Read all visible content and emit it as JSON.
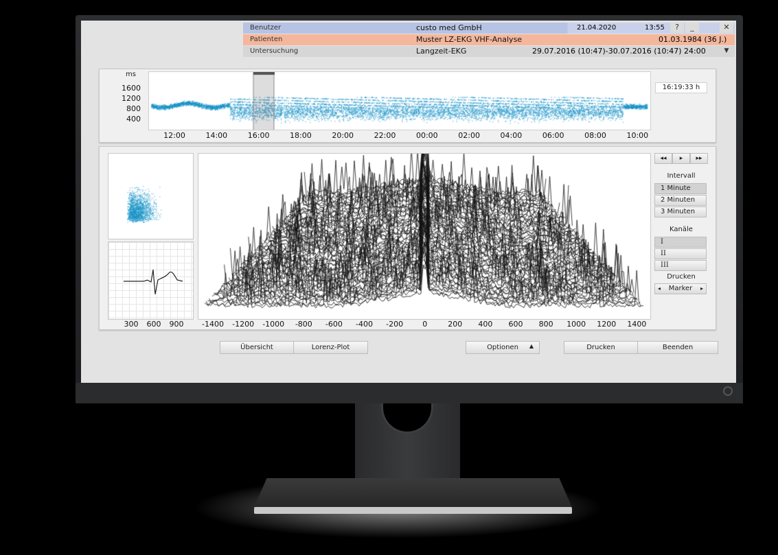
{
  "header": {
    "rows": [
      {
        "label": "Benutzer",
        "value": "custo med GmbH",
        "extra1": "21.04.2020",
        "extra2": "13:55"
      },
      {
        "label": "Patienten",
        "value": "Muster LZ-EKG VHF-Analyse",
        "extra1": "01.03.1984 (36 J.)"
      },
      {
        "label": "Untersuchung",
        "value": "Langzeit-EKG",
        "extra1": "29.07.2016 (10:47)-30.07.2016 (10:47) 24:00"
      }
    ],
    "help_label": "?",
    "minimize_label": "_",
    "close_label": "✕",
    "dropdown_label": "▼"
  },
  "trend": {
    "unit_label": "ms",
    "y_ticks": [
      "1600",
      "1200",
      "800",
      "400"
    ],
    "x_ticks": [
      "12:00",
      "14:00",
      "16:00",
      "18:00",
      "20:00",
      "22:00",
      "00:00",
      "02:00",
      "04:00",
      "06:00",
      "08:00",
      "10:00"
    ],
    "time_readout": "16:19:33 h",
    "color": "#1a94c8"
  },
  "main": {
    "scatter_x_ticks": [
      "300",
      "600",
      "900"
    ],
    "waterfall_x_ticks": [
      "-1400",
      "-1200",
      "-1000",
      "-800",
      "-600",
      "-400",
      "-200",
      "0",
      "200",
      "400",
      "600",
      "800",
      "1000",
      "1200",
      "1400"
    ]
  },
  "sidebar": {
    "nav_buttons": [
      "◂◂",
      "▸",
      "▸▸"
    ],
    "interval_label": "Intervall",
    "interval_options": [
      "1 Minute",
      "2 Minuten",
      "3 Minuten"
    ],
    "interval_selected": "1 Minute",
    "channels_label": "Kanäle",
    "channel_options": [
      "I",
      "II",
      "III"
    ],
    "channel_selected": "I",
    "print_label": "Drucken",
    "marker_label": "Marker",
    "marker_prev": "◂",
    "marker_next": "▸"
  },
  "footer": {
    "overview": "Übersicht",
    "lorenz": "Lorenz-Plot",
    "options": "Optionen",
    "options_arrow": "▲",
    "print": "Drucken",
    "exit": "Beenden"
  }
}
